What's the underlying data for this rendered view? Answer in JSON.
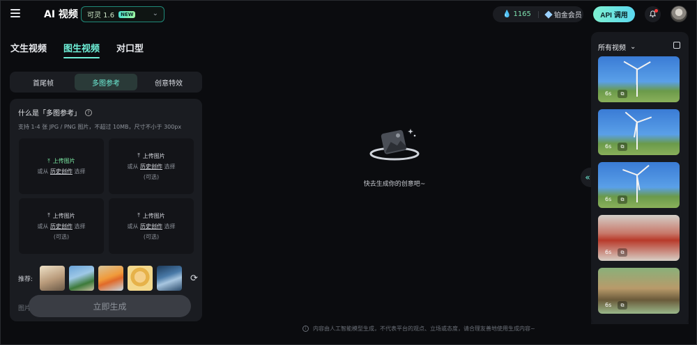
{
  "header": {
    "app_title": "AI 视频",
    "model_name": "可灵 1.6",
    "new_badge": "NEW",
    "points": "1165",
    "membership": "铂金会员",
    "api_label": "API 调用"
  },
  "mode_tabs": [
    "文生视频",
    "图生视频",
    "对口型"
  ],
  "active_mode": "图生视频",
  "sub_tabs": [
    "首尾帧",
    "多图参考",
    "创意特效"
  ],
  "active_sub_tab": "多图参考",
  "reference": {
    "title": "什么是「多图参考」",
    "description": "支持 1-4 张 JPG / PNG 图片，不超过 10MB，尺寸不小于 300px",
    "upload_label": "上传图片",
    "from_prefix": "或从",
    "history_link": "历史创作",
    "select_suffix": "选择",
    "optional": "(可选)"
  },
  "recommend": {
    "label": "推荐:"
  },
  "image_label_cut": "图片",
  "generate_label": "立即生成",
  "empty_state_text": "快去生成你的创意吧~",
  "disclaimer": "内容由人工智能模型生成，不代表平台的观点、立场或态度，请合理友善地使用生成内容~",
  "right_panel": {
    "title": "所有视频",
    "videos": [
      {
        "duration": "6s",
        "scene": "wind-turbine"
      },
      {
        "duration": "6s",
        "scene": "wind-turbine"
      },
      {
        "duration": "6s",
        "scene": "wind-turbine"
      },
      {
        "duration": "6s",
        "scene": "festive-decoration"
      },
      {
        "duration": "6s",
        "scene": "owl"
      }
    ]
  },
  "colors": {
    "accent": "#6ff0d8",
    "points": "#7fe3b0",
    "background": "#0b0c0f"
  }
}
